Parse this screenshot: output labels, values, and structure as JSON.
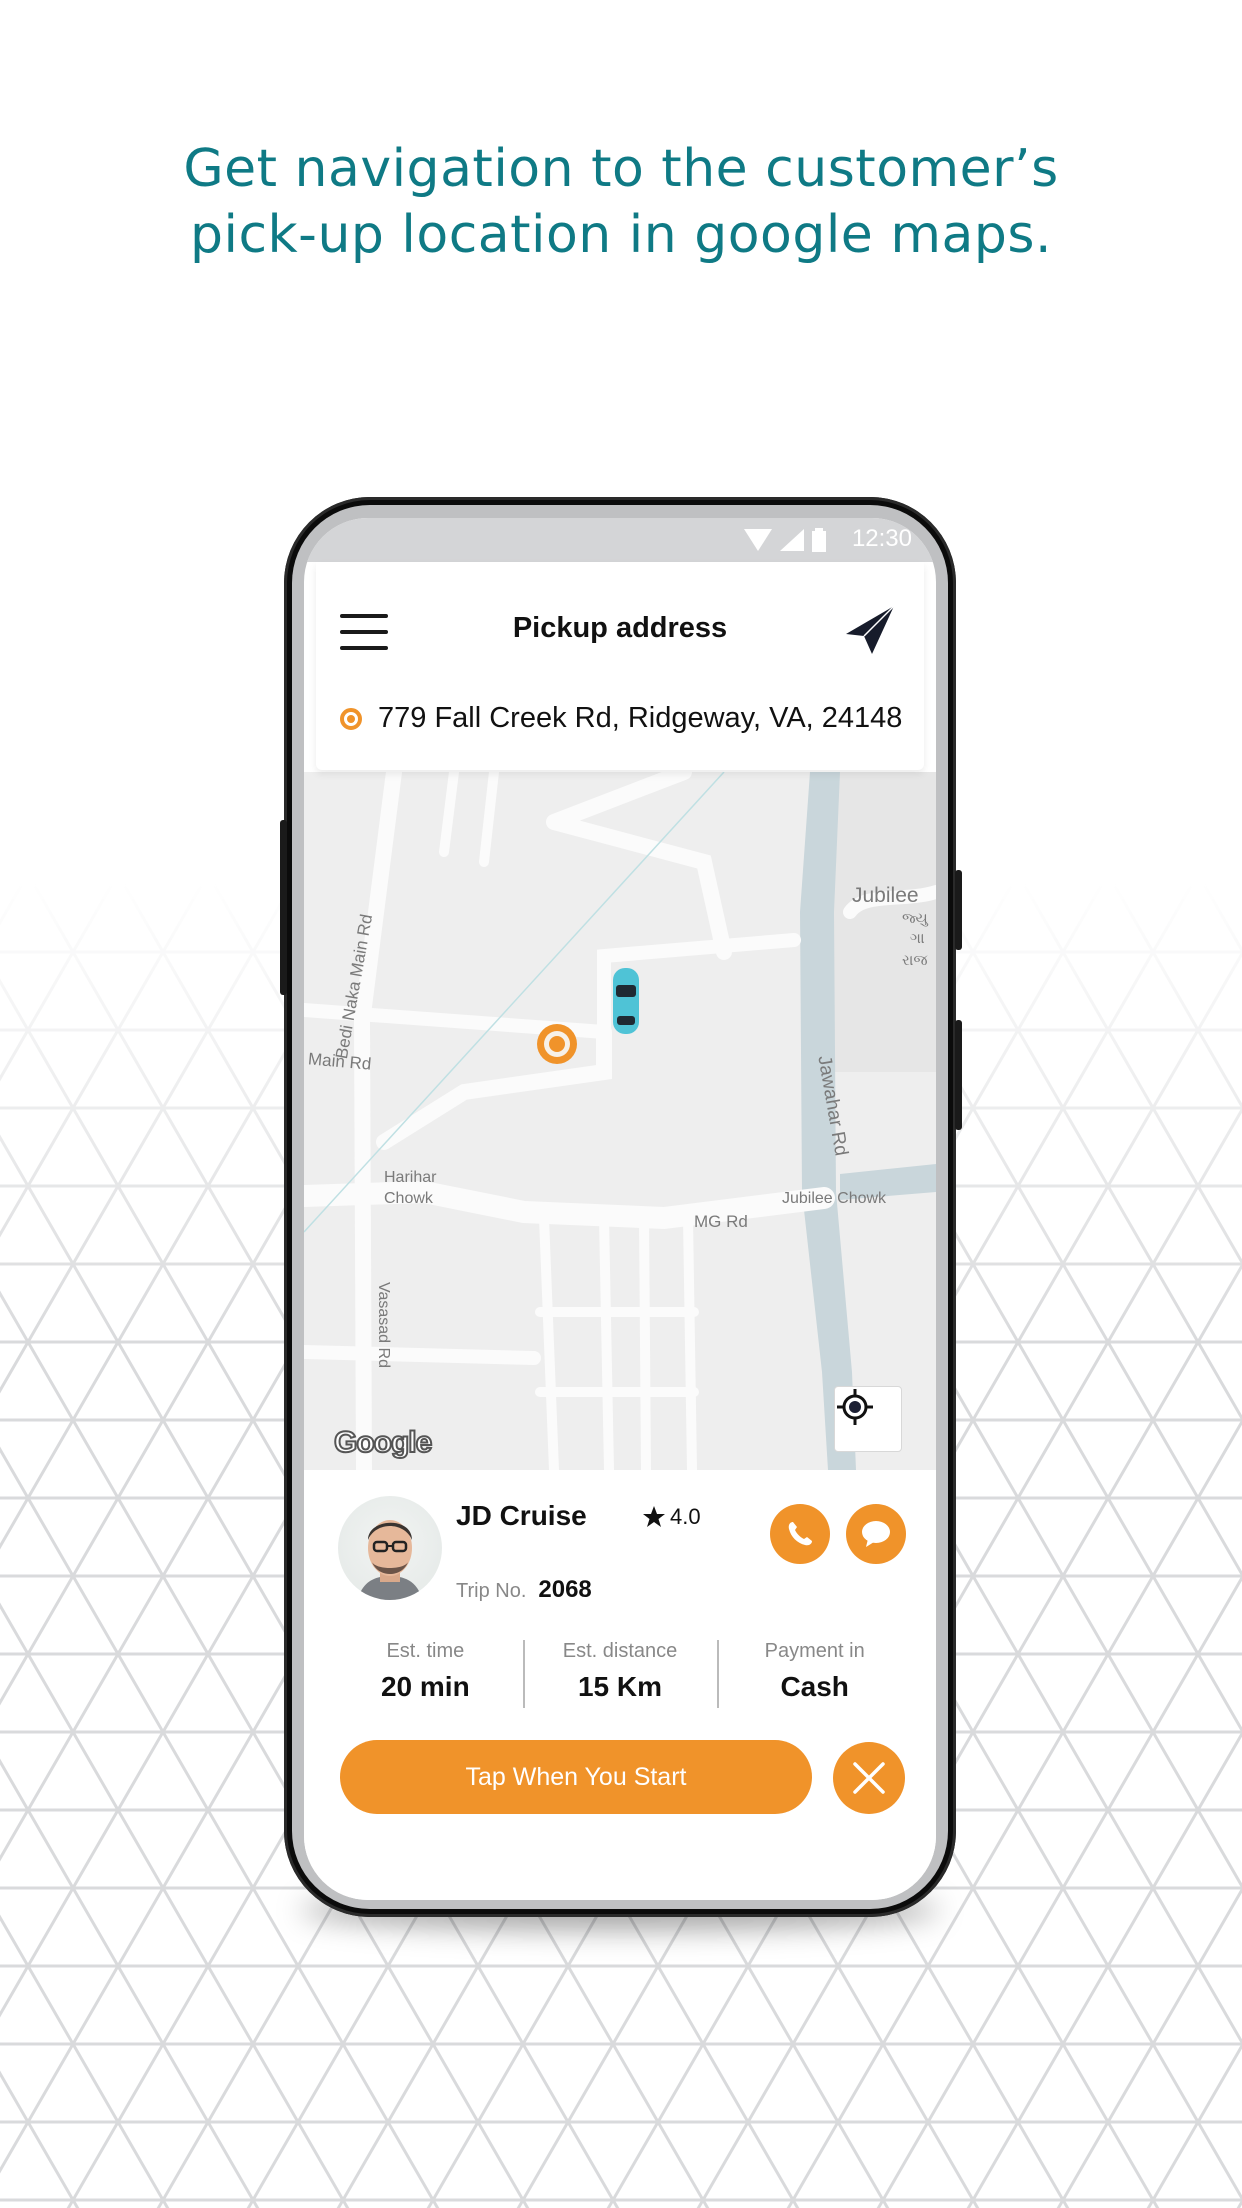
{
  "headline": {
    "line1": "Get navigation to the customer’s",
    "line2": "pick-up location in google maps."
  },
  "status_bar": {
    "time": "12:30",
    "icons": [
      "wifi-icon",
      "signal-icon",
      "battery-icon"
    ]
  },
  "header": {
    "menu_icon": "hamburger-menu-icon",
    "title": "Pickup address",
    "navigate_icon": "paper-plane-navigation-icon",
    "pickup_icon": "location-target-icon",
    "pickup_address": "779 Fall Creek Rd, Ridgeway, VA, 24148"
  },
  "map": {
    "labels": {
      "bedi_naka": "Bedi Naka Main Rd",
      "main_rd": "Main Rd",
      "jubilee": "Jubilee",
      "gujarati_1": "જ્યુ",
      "gujarati_2": "ગા",
      "gujarati_3": "રાજ",
      "jawahar": "Jawahar Rd",
      "harihar_1": "Harihar",
      "harihar_2": "Chowk",
      "jubilee_chowk": "Jubilee Chowk",
      "mg_rd": "MG Rd",
      "vasasad": "Vasasad Rd"
    },
    "attribution": "Google",
    "pickup_marker_icon": "pickup-marker-icon",
    "car_icon": "car-icon",
    "locate_icon": "my-location-icon",
    "colors": {
      "water": "#c9d6db",
      "land": "#eeeeee",
      "road": "#fbfbfb",
      "car": "#4fc3d6",
      "marker": "#f0932a"
    }
  },
  "driver": {
    "name": "JD Cruise",
    "rating": "4.0",
    "trip_label": "Trip No.",
    "trip_number": "2068",
    "call_icon": "phone-icon",
    "message_icon": "chat-bubble-icon"
  },
  "trip_stats": [
    {
      "label": "Est. time",
      "value": "20 min"
    },
    {
      "label": "Est. distance",
      "value": "15 Km"
    },
    {
      "label": "Payment in",
      "value": "Cash"
    }
  ],
  "actions": {
    "start_label": "Tap When You Start",
    "cancel_icon": "close-icon"
  },
  "colors": {
    "accent": "#f0932a",
    "headline": "#0f7a85"
  }
}
